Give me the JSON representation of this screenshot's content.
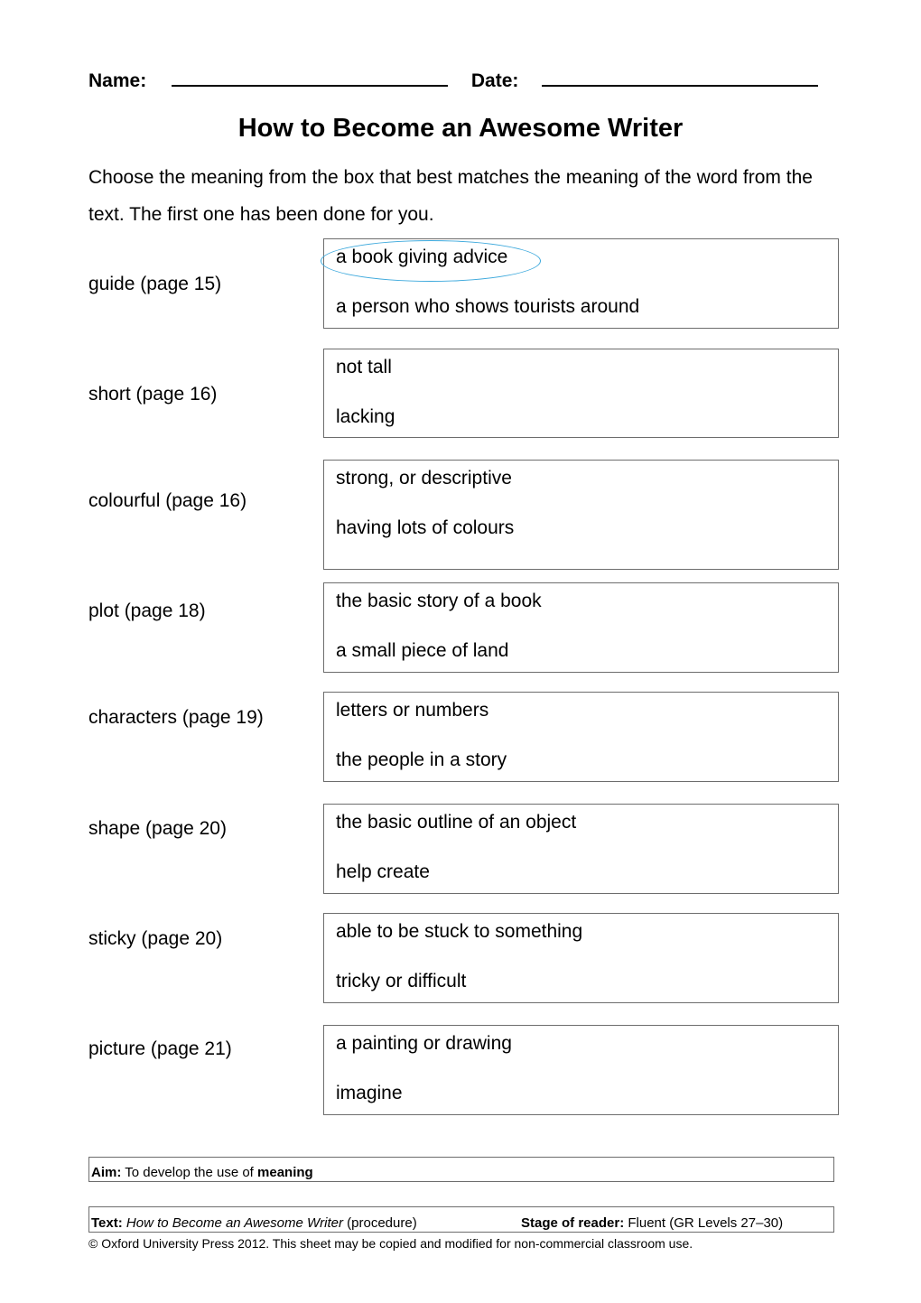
{
  "header": {
    "name_label": "Name:",
    "date_label": "Date:"
  },
  "title": "How to Become an Awesome Writer",
  "instructions": "Choose the meaning from the box that best matches the meaning of the word from the text. The first one has been done for you.",
  "items": [
    {
      "word": "guide (page 15)",
      "options": [
        "a book giving advice",
        "a person who shows tourists around"
      ],
      "circled": 0
    },
    {
      "word": "short (page 16)",
      "options": [
        "not tall",
        "lacking"
      ]
    },
    {
      "word": "colourful (page 16)",
      "options": [
        "strong, or descriptive",
        "having lots of colours"
      ]
    },
    {
      "word": "plot (page 18)",
      "options": [
        "the basic story of a book",
        "a small piece of land"
      ]
    },
    {
      "word": "characters (page 19)",
      "options": [
        "letters or numbers",
        "the people in a story"
      ]
    },
    {
      "word": "shape (page 20)",
      "options": [
        "the basic outline of an object",
        "help create"
      ]
    },
    {
      "word": "sticky (page 20)",
      "options": [
        "able to be stuck to something",
        "tricky or difficult"
      ]
    },
    {
      "word": "picture (page 21)",
      "options": [
        "a painting or drawing",
        "imagine"
      ]
    }
  ],
  "footer": {
    "aim_label": "Aim:",
    "aim_text": " To develop the use of ",
    "aim_bold": "meaning",
    "text_label": "Text:",
    "text_title": "How to Become an Awesome Writer",
    "text_type": " (procedure)",
    "stage_label": "Stage of reader:",
    "stage_value": " Fluent (GR Levels 27–30)",
    "copyright": "© Oxford University Press 2012. This sheet may be copied and modified for non-commercial classroom use."
  },
  "colors": {
    "circle": "#3ba8dc",
    "box_border": "#6d6d6d"
  }
}
